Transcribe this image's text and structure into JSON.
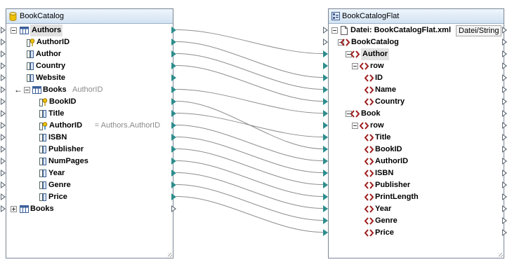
{
  "left": {
    "title": "BookCatalog",
    "rows": [
      {
        "label": "Authors",
        "sub": "",
        "indent": 0,
        "icon": "table-icon",
        "expander": "minus",
        "highlight": true,
        "in": true,
        "out": "filled",
        "arrow": false,
        "bold_only": true
      },
      {
        "label": "AuthorID",
        "sub": "",
        "indent": 1,
        "icon": "key-column-icon",
        "expander": "",
        "highlight": false,
        "in": true,
        "out": "filled",
        "arrow": false
      },
      {
        "label": "Author",
        "sub": "",
        "indent": 1,
        "icon": "column-icon",
        "expander": "",
        "highlight": false,
        "in": true,
        "out": "filled",
        "arrow": false
      },
      {
        "label": "Country",
        "sub": "",
        "indent": 1,
        "icon": "column-icon",
        "expander": "",
        "highlight": false,
        "in": true,
        "out": "filled",
        "arrow": false
      },
      {
        "label": "Website",
        "sub": "",
        "indent": 1,
        "icon": "column-icon",
        "expander": "",
        "highlight": false,
        "in": true,
        "out": "filled",
        "arrow": false
      },
      {
        "label": "Books",
        "sub": "AuthorID",
        "indent": 1,
        "icon": "table-icon",
        "expander": "minus",
        "highlight": false,
        "in": true,
        "out": "filled",
        "arrow": true
      },
      {
        "label": "BookID",
        "sub": "",
        "indent": 2,
        "icon": "key-column-icon",
        "expander": "",
        "highlight": false,
        "in": true,
        "out": "filled",
        "arrow": false
      },
      {
        "label": "Title",
        "sub": "",
        "indent": 2,
        "icon": "column-icon",
        "expander": "",
        "highlight": false,
        "in": true,
        "out": "filled",
        "arrow": false
      },
      {
        "label": "AuthorID",
        "sub": "= Authors.AuthorID",
        "indent": 2,
        "icon": "foreign-key-column-icon",
        "expander": "",
        "highlight": false,
        "in": true,
        "out": "filled",
        "arrow": false
      },
      {
        "label": "ISBN",
        "sub": "",
        "indent": 2,
        "icon": "column-icon",
        "expander": "",
        "highlight": false,
        "in": true,
        "out": "filled",
        "arrow": false
      },
      {
        "label": "Publisher",
        "sub": "",
        "indent": 2,
        "icon": "column-icon",
        "expander": "",
        "highlight": false,
        "in": true,
        "out": "filled",
        "arrow": false
      },
      {
        "label": "NumPages",
        "sub": "",
        "indent": 2,
        "icon": "column-icon",
        "expander": "",
        "highlight": false,
        "in": true,
        "out": "filled",
        "arrow": false
      },
      {
        "label": "Year",
        "sub": "",
        "indent": 2,
        "icon": "column-icon",
        "expander": "",
        "highlight": false,
        "in": true,
        "out": "filled",
        "arrow": false
      },
      {
        "label": "Genre",
        "sub": "",
        "indent": 2,
        "icon": "column-icon",
        "expander": "",
        "highlight": false,
        "in": true,
        "out": "filled",
        "arrow": false
      },
      {
        "label": "Price",
        "sub": "",
        "indent": 2,
        "icon": "column-icon",
        "expander": "",
        "highlight": false,
        "in": true,
        "out": "filled",
        "arrow": false
      },
      {
        "label": "Books",
        "sub": "",
        "indent": 0,
        "icon": "table-icon",
        "expander": "plus",
        "highlight": false,
        "in": true,
        "out": "hollow",
        "arrow": false
      }
    ]
  },
  "right": {
    "title": "BookCatalogFlat",
    "file_label": "Datei: BookCatalogFlat.xml",
    "file_button": "Datei/String",
    "rows": [
      {
        "label": "BookCatalog",
        "indent": 0,
        "expander": "minus",
        "highlight": false,
        "in": "hollow",
        "out": true
      },
      {
        "label": "Author",
        "indent": 1,
        "expander": "minus",
        "highlight": true,
        "in": "filled",
        "out": true
      },
      {
        "label": "row",
        "indent": 2,
        "expander": "minus",
        "highlight": false,
        "in": "filled",
        "out": true
      },
      {
        "label": "ID",
        "indent": 3,
        "expander": "",
        "highlight": false,
        "in": "filled",
        "out": true
      },
      {
        "label": "Name",
        "indent": 3,
        "expander": "",
        "highlight": false,
        "in": "filled",
        "out": true
      },
      {
        "label": "Country",
        "indent": 3,
        "expander": "",
        "highlight": false,
        "in": "filled",
        "out": true
      },
      {
        "label": "Book",
        "indent": 1,
        "expander": "minus",
        "highlight": false,
        "in": "filled",
        "out": true
      },
      {
        "label": "row",
        "indent": 2,
        "expander": "minus",
        "highlight": false,
        "in": "filled",
        "out": true
      },
      {
        "label": "Title",
        "indent": 3,
        "expander": "",
        "highlight": false,
        "in": "filled",
        "out": true
      },
      {
        "label": "BookID",
        "indent": 3,
        "expander": "",
        "highlight": false,
        "in": "filled",
        "out": true
      },
      {
        "label": "AuthorID",
        "indent": 3,
        "expander": "",
        "highlight": false,
        "in": "filled",
        "out": true
      },
      {
        "label": "ISBN",
        "indent": 3,
        "expander": "",
        "highlight": false,
        "in": "filled",
        "out": true
      },
      {
        "label": "Publisher",
        "indent": 3,
        "expander": "",
        "highlight": false,
        "in": "filled",
        "out": true
      },
      {
        "label": "PrintLength",
        "indent": 3,
        "expander": "",
        "highlight": false,
        "in": "filled",
        "out": true
      },
      {
        "label": "Year",
        "indent": 3,
        "expander": "",
        "highlight": false,
        "in": "filled",
        "out": true
      },
      {
        "label": "Genre",
        "indent": 3,
        "expander": "",
        "highlight": false,
        "in": "filled",
        "out": true
      },
      {
        "label": "Price",
        "indent": 3,
        "expander": "",
        "highlight": false,
        "in": "filled",
        "out": true
      }
    ]
  },
  "connections": [
    {
      "from": "Authors",
      "to": "Author"
    },
    {
      "from": "AuthorID",
      "to": "ID"
    },
    {
      "from": "Author",
      "to": "Name"
    },
    {
      "from": "Country",
      "to": "Country"
    },
    {
      "from": "Books",
      "to": "Book"
    },
    {
      "from": "BookID",
      "to": "BookID"
    },
    {
      "from": "Title",
      "to": "Title"
    },
    {
      "from": "AuthorID (Books)",
      "to": "AuthorID"
    },
    {
      "from": "ISBN",
      "to": "ISBN"
    },
    {
      "from": "Publisher",
      "to": "Publisher"
    },
    {
      "from": "NumPages",
      "to": "PrintLength"
    },
    {
      "from": "Year",
      "to": "Year"
    },
    {
      "from": "Genre",
      "to": "Genre"
    },
    {
      "from": "Price",
      "to": "Price"
    }
  ],
  "colors": {
    "connector": "#8e8e8e",
    "pin": "#2e8d8d",
    "xml_icon": "#9c1c1c",
    "db_icon": "#e3b400"
  }
}
